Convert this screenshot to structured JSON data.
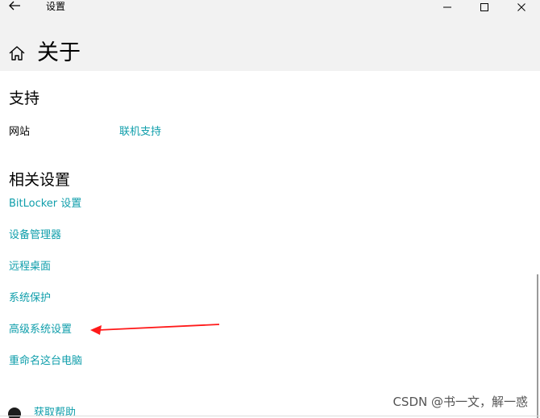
{
  "window": {
    "back_icon": "back-arrow-icon",
    "app_title": "设置",
    "controls": [
      "minimize-icon",
      "maximize-icon",
      "close-icon"
    ]
  },
  "page": {
    "home_icon": "home-icon",
    "title": "关于"
  },
  "support": {
    "title": "支持",
    "row_label": "网站",
    "row_link": "联机支持"
  },
  "related": {
    "title": "相关设置",
    "links": [
      "BitLocker 设置",
      "设备管理器",
      "远程桌面",
      "系统保护",
      "高级系统设置",
      "重命名这台电脑"
    ]
  },
  "help": {
    "icon": "help-icon",
    "label": "获取帮助"
  },
  "watermark": "CSDN @书一文，解一惑",
  "colors": {
    "link": "#0f9eab",
    "header_bg": "#f2f2f2",
    "arrow": "#ff1a1a"
  }
}
